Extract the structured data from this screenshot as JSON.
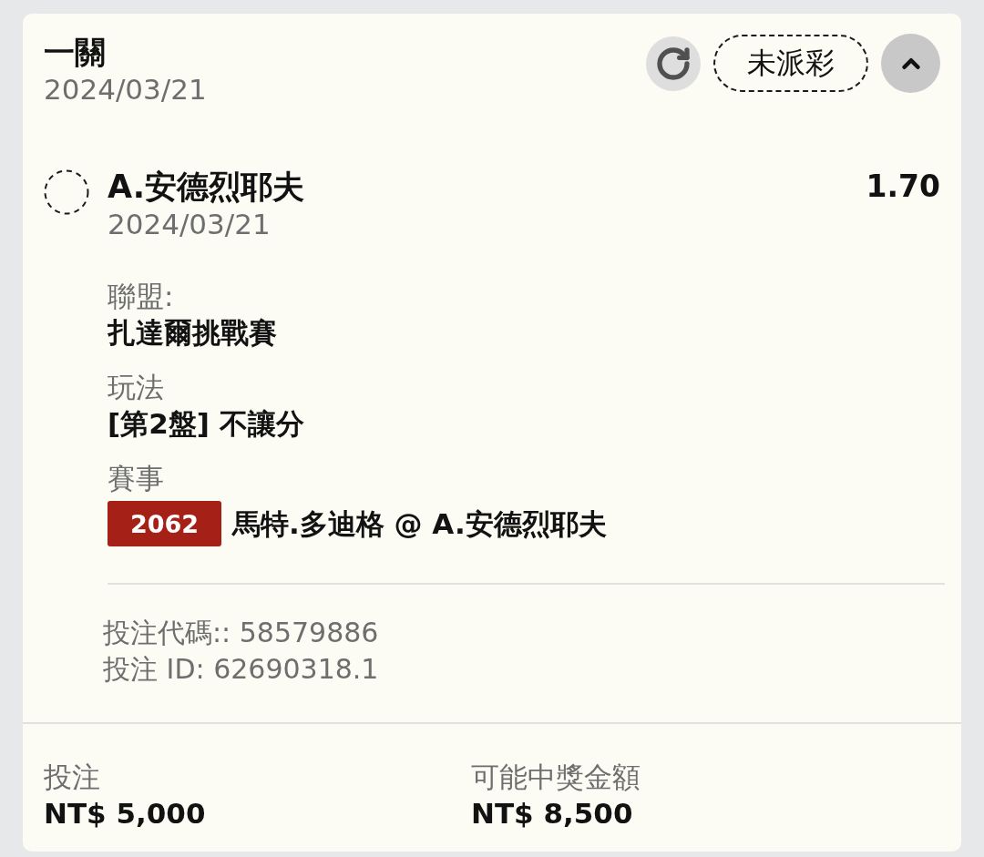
{
  "bet": {
    "title": "一關",
    "date": "2024/03/21",
    "status": "未派彩",
    "expanded": true
  },
  "selection": {
    "name": "A.安德烈耶夫",
    "date": "2024/03/21",
    "odds": "1.70"
  },
  "details": [
    {
      "label": "聯盟:",
      "value": "扎達爾挑戰賽"
    },
    {
      "label": "玩法",
      "value": "[第2盤] 不讓分"
    },
    {
      "label": "賽事",
      "badge": "2062",
      "value": "馬特.多迪格 @ A.安德烈耶夫"
    }
  ],
  "references": [
    "投注代碼:: 58579886",
    "投注 ID: 62690318.1"
  ],
  "summary": [
    {
      "label": "投注",
      "value": "NT$ 5,000"
    },
    {
      "label": "可能中獎金額",
      "value": "NT$ 8,500"
    }
  ]
}
